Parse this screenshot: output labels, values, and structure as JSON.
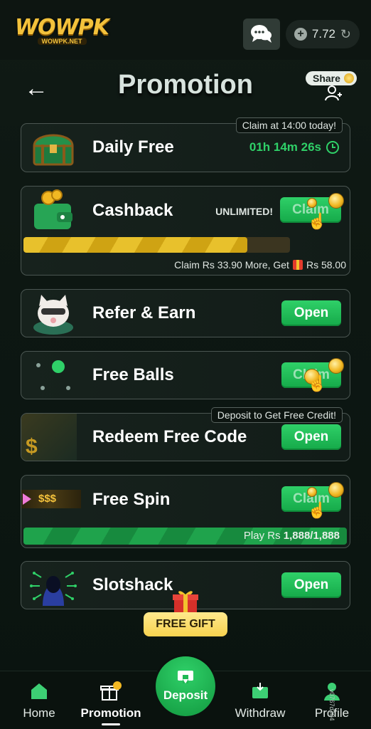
{
  "brand": {
    "logo": "WOWPK",
    "logo_sub": "WOWPK.NET"
  },
  "account": {
    "balance": "7.72"
  },
  "header": {
    "title": "Promotion",
    "share_label": "Share"
  },
  "cards": {
    "daily_free": {
      "label": "Daily Free",
      "tag": "Claim at 14:00 today!",
      "countdown": "01h 14m 26s"
    },
    "cashback": {
      "label": "Cashback",
      "badge": "UNLIMITED!",
      "button": "Claim",
      "progress": 0.84,
      "info_prefix": "Claim Rs 33.90 More, Get",
      "info_reward": "Rs 58.00"
    },
    "refer": {
      "label": "Refer & Earn",
      "button": "Open"
    },
    "free_balls": {
      "label": "Free Balls",
      "button": "Claim"
    },
    "redeem": {
      "label": "Redeem Free Code",
      "tag": "Deposit to Get Free Credit!",
      "button": "Open",
      "icon_text": "$"
    },
    "free_spin": {
      "label": "Free Spin",
      "button": "Claim",
      "icon_text": "$$$",
      "progress": 1.0,
      "progress_label": "Play Rs",
      "progress_value": "1,888/1,888"
    },
    "slotshack": {
      "label": "Slotshack",
      "button": "Open"
    }
  },
  "free_gift": {
    "label": "FREE GIFT"
  },
  "bottom_nav": {
    "home": "Home",
    "promotion": "Promotion",
    "deposit": "Deposit",
    "withdraw": "Withdraw",
    "profile": "Profile"
  },
  "version": "v0767d304",
  "colors": {
    "accent_green": "#1fb954",
    "gold": "#f3c23c",
    "background": "#0d1712"
  }
}
